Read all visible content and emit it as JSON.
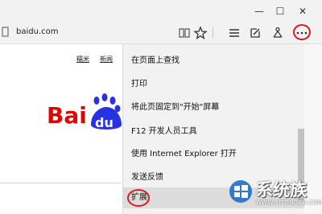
{
  "window": {
    "minimize_glyph": "—",
    "maximize_glyph": "☐",
    "close_glyph": "✕"
  },
  "address": {
    "url": "baidu.com"
  },
  "toolbar": {
    "icons": [
      "reading-view-icon",
      "favorite-star-icon",
      "hub-icon",
      "web-note-icon",
      "share-icon",
      "more-icon"
    ]
  },
  "page": {
    "links": [
      "糯米",
      "新闻"
    ],
    "logo_text": "Baidu"
  },
  "menu": {
    "items": [
      {
        "label": "在页面上查找"
      },
      {
        "label": "打印"
      },
      {
        "label": "将此页固定到\"开始\"屏幕"
      },
      {
        "label": "F12 开发人员工具"
      },
      {
        "label": "使用 Internet Explorer 打开"
      },
      {
        "label": "发送反馈"
      },
      {
        "label": "扩展"
      }
    ]
  },
  "watermark": {
    "title": "系统族",
    "subtitle": "WWW.XITONGZU.COM"
  },
  "colors": {
    "highlight_ring": "#d81e1e",
    "baidu_red": "#e10602",
    "baidu_blue": "#2932e1"
  }
}
